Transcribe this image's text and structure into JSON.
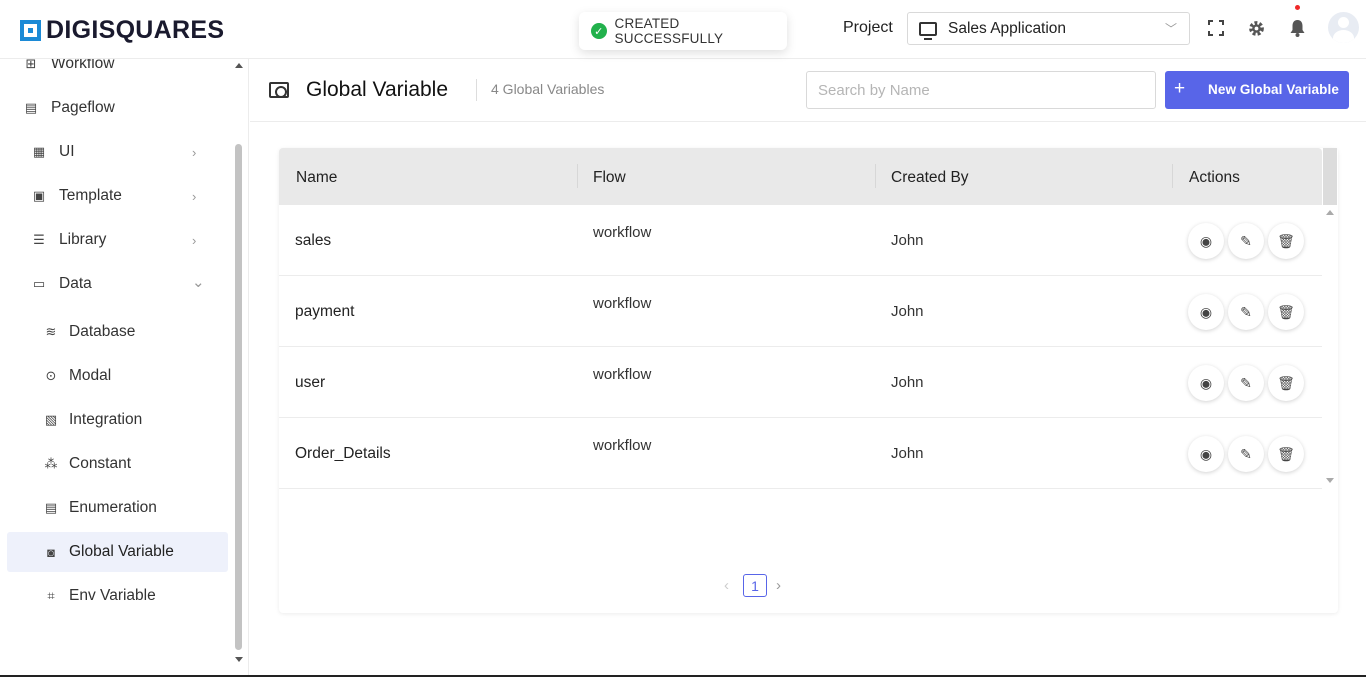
{
  "header": {
    "logo": "DIGISQUARES",
    "toast": "CREATED SUCCESSFULLY",
    "project_label": "Project",
    "project_value": "Sales Application"
  },
  "sidebar": {
    "items": [
      {
        "label": "Workflow",
        "icon": "workflow-icon"
      },
      {
        "label": "Pageflow",
        "icon": "pageflow-icon"
      },
      {
        "label": "UI",
        "icon": "ui-icon",
        "chevron": "›"
      },
      {
        "label": "Template",
        "icon": "template-icon",
        "chevron": "›"
      },
      {
        "label": "Library",
        "icon": "library-icon",
        "chevron": "›"
      },
      {
        "label": "Data",
        "icon": "data-icon",
        "chevron": "⌄"
      },
      {
        "label": "Database",
        "icon": "database-icon"
      },
      {
        "label": "Modal",
        "icon": "modal-icon"
      },
      {
        "label": "Integration",
        "icon": "integration-icon"
      },
      {
        "label": "Constant",
        "icon": "constant-icon"
      },
      {
        "label": "Enumeration",
        "icon": "enumeration-icon"
      },
      {
        "label": "Global Variable",
        "icon": "global-variable-icon"
      },
      {
        "label": "Env Variable",
        "icon": "env-variable-icon"
      }
    ]
  },
  "main": {
    "title": "Global Variable",
    "count": "4 Global Variables",
    "search_placeholder": "Search by Name",
    "new_button": "New Global Variable",
    "columns": [
      "Name",
      "Flow",
      "Created By",
      "Actions"
    ],
    "rows": [
      {
        "name": "sales",
        "flow": "workflow",
        "created_by": "John"
      },
      {
        "name": "payment",
        "flow": "workflow",
        "created_by": "John"
      },
      {
        "name": "user",
        "flow": "workflow",
        "created_by": "John"
      },
      {
        "name": "Order_Details",
        "flow": "workflow",
        "created_by": "John"
      }
    ],
    "pagination": {
      "current": "1"
    }
  },
  "colors": {
    "accent": "#5865e8",
    "logo": "#1c8ad6",
    "success": "#22b14c"
  }
}
